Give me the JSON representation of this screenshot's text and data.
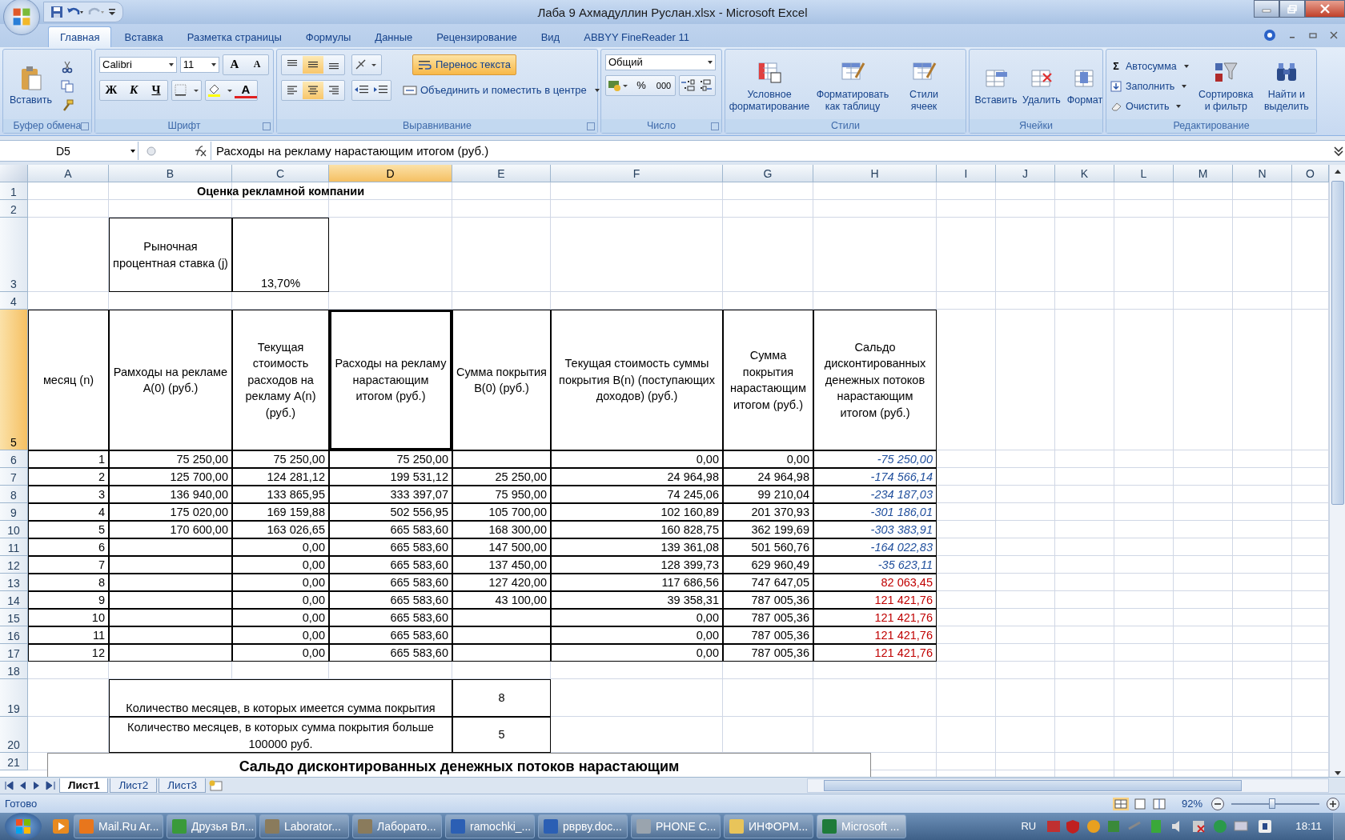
{
  "window": {
    "title": "Лаба 9 Ахмадуллин  Руслан.xlsx - Microsoft Excel"
  },
  "ribbon_tabs": [
    {
      "label": "Главная",
      "selected": true
    },
    {
      "label": "Вставка",
      "selected": false
    },
    {
      "label": "Разметка страницы",
      "selected": false
    },
    {
      "label": "Формулы",
      "selected": false
    },
    {
      "label": "Данные",
      "selected": false
    },
    {
      "label": "Рецензирование",
      "selected": false
    },
    {
      "label": "Вид",
      "selected": false
    },
    {
      "label": "ABBYY FineReader 11",
      "selected": false
    }
  ],
  "ribbon": {
    "clipboard": {
      "label": "Буфер обмена",
      "paste": "Вставить"
    },
    "font": {
      "label": "Шрифт",
      "family": "Calibri",
      "size": "11",
      "grow": "A",
      "shrink": "A",
      "styles": [
        "Ж",
        "К",
        "Ч"
      ],
      "color_letter": "A"
    },
    "alignment": {
      "label": "Выравнивание",
      "vertical": [
        {
          "selected": false
        },
        {
          "selected": true
        },
        {
          "selected": false
        }
      ],
      "horizontal": [
        {
          "selected": false
        },
        {
          "selected": true
        },
        {
          "selected": false
        }
      ],
      "wrap": {
        "label": "Перенос текста",
        "on": true
      },
      "merge": "Объединить и поместить в центре"
    },
    "number": {
      "label": "Число",
      "format": "Общий",
      "percent": "%",
      "thousands": "000"
    },
    "styles": {
      "label": "Стили",
      "buttons": [
        "Условное форматирование",
        "Форматировать как таблицу",
        "Стили ячеек"
      ]
    },
    "cells": {
      "label": "Ячейки",
      "buttons": [
        "Вставить",
        "Удалить",
        "Формат"
      ]
    },
    "editing": {
      "label": "Редактирование",
      "sum_sign": "Σ",
      "small": [
        "Автосумма",
        "Заполнить",
        "Очистить"
      ],
      "big": [
        "Сортировка и фильтр",
        "Найти и выделить"
      ]
    }
  },
  "formula_bar": {
    "name_box": "D5",
    "value": "Расходы на рекламу нарастающим итогом (руб.)"
  },
  "columns": [
    {
      "label": "A",
      "selected": false
    },
    {
      "label": "B",
      "selected": false
    },
    {
      "label": "C",
      "selected": false
    },
    {
      "label": "D",
      "selected": true
    },
    {
      "label": "E",
      "selected": false
    },
    {
      "label": "F",
      "selected": false
    },
    {
      "label": "G",
      "selected": false
    },
    {
      "label": "H",
      "selected": false
    },
    {
      "label": "I",
      "selected": false
    },
    {
      "label": "J",
      "selected": false
    },
    {
      "label": "K",
      "selected": false
    },
    {
      "label": "L",
      "selected": false
    },
    {
      "label": "M",
      "selected": false
    },
    {
      "label": "N",
      "selected": false
    },
    {
      "label": "O",
      "selected": false
    }
  ],
  "row_headers": [
    {
      "label": "1",
      "selected": false
    },
    {
      "label": "2",
      "selected": false
    },
    {
      "label": "3",
      "selected": false
    },
    {
      "label": "4",
      "selected": false
    },
    {
      "label": "5",
      "selected": true
    },
    {
      "label": "6",
      "selected": false
    },
    {
      "label": "7",
      "selected": false
    },
    {
      "label": "8",
      "selected": false
    },
    {
      "label": "9",
      "selected": false
    },
    {
      "label": "10",
      "selected": false
    },
    {
      "label": "11",
      "selected": false
    },
    {
      "label": "12",
      "selected": false
    },
    {
      "label": "13",
      "selected": false
    },
    {
      "label": "14",
      "selected": false
    },
    {
      "label": "15",
      "selected": false
    },
    {
      "label": "16",
      "selected": false
    },
    {
      "label": "17",
      "selected": false
    },
    {
      "label": "18",
      "selected": false
    },
    {
      "label": "19",
      "selected": false
    },
    {
      "label": "20",
      "selected": false
    },
    {
      "label": "21",
      "selected": false
    }
  ],
  "sheet_title": "Оценка рекламной компании",
  "rate": {
    "label": "Рыночная процентная ставка (j)",
    "value": "13,70%"
  },
  "table": {
    "headers": [
      "месяц (n)",
      "Рамходы на рекламе А(0)   (руб.)",
      "Текущая стоимость расходов на рекламу А(n) (руб.)",
      "Расходы на рекламу нарастающим итогом (руб.)",
      "Сумма покрытия В(0) (руб.)",
      "Текущая стоимость суммы покрытия В(n) (поступающих доходов) (руб.)",
      "Сумма покрытия нарастающим итогом (руб.)",
      "Сальдо дисконтированных денежных потоков нарастающим итогом (руб.)"
    ],
    "rows": [
      {
        "n": "1",
        "ads": "75 250,00",
        "ads_pv": "75 250,00",
        "ads_total": "75 250,00",
        "cover_pv": "0,00",
        "cover_total": "0,00",
        "balance": "-75 250,00",
        "kind": "negative"
      },
      {
        "n": "2",
        "ads": "125 700,00",
        "ads_pv": "124 281,12",
        "ads_total": "199 531,12",
        "cover": "25 250,00",
        "cover_pv": "24 964,98",
        "cover_total": "24 964,98",
        "balance": "-174 566,14",
        "kind": "negative"
      },
      {
        "n": "3",
        "ads": "136 940,00",
        "ads_pv": "133 865,95",
        "ads_total": "333 397,07",
        "cover": "75 950,00",
        "cover_pv": "74 245,06",
        "cover_total": "99 210,04",
        "balance": "-234 187,03",
        "kind": "negative"
      },
      {
        "n": "4",
        "ads": "175 020,00",
        "ads_pv": "169 159,88",
        "ads_total": "502 556,95",
        "cover": "105 700,00",
        "cover_pv": "102 160,89",
        "cover_total": "201 370,93",
        "balance": "-301 186,01",
        "kind": "negative"
      },
      {
        "n": "5",
        "ads": "170 600,00",
        "ads_pv": "163 026,65",
        "ads_total": "665 583,60",
        "cover": "168 300,00",
        "cover_pv": "160 828,75",
        "cover_total": "362 199,69",
        "balance": "-303 383,91",
        "kind": "negative"
      },
      {
        "n": "6",
        "ads_pv": "0,00",
        "ads_total": "665 583,60",
        "cover": "147 500,00",
        "cover_pv": "139 361,08",
        "cover_total": "501 560,76",
        "balance": "-164 022,83",
        "kind": "negative"
      },
      {
        "n": "7",
        "ads_pv": "0,00",
        "ads_total": "665 583,60",
        "cover": "137 450,00",
        "cover_pv": "128 399,73",
        "cover_total": "629 960,49",
        "balance": "-35 623,11",
        "kind": "negative"
      },
      {
        "n": "8",
        "ads_pv": "0,00",
        "ads_total": "665 583,60",
        "cover": "127 420,00",
        "cover_pv": "117 686,56",
        "cover_total": "747 647,05",
        "balance": "82 063,45",
        "kind": "positive"
      },
      {
        "n": "9",
        "ads_pv": "0,00",
        "ads_total": "665 583,60",
        "cover": "43 100,00",
        "cover_pv": "39 358,31",
        "cover_total": "787 005,36",
        "balance": "121 421,76",
        "kind": "positive"
      },
      {
        "n": "10",
        "ads_pv": "0,00",
        "ads_total": "665 583,60",
        "cover_pv": "0,00",
        "cover_total": "787 005,36",
        "balance": "121 421,76",
        "kind": "positive"
      },
      {
        "n": "11",
        "ads_pv": "0,00",
        "ads_total": "665 583,60",
        "cover_pv": "0,00",
        "cover_total": "787 005,36",
        "balance": "121 421,76",
        "kind": "positive"
      },
      {
        "n": "12",
        "ads_pv": "0,00",
        "ads_total": "665 583,60",
        "cover_pv": "0,00",
        "cover_total": "787 005,36",
        "balance": "121 421,76",
        "kind": "positive"
      }
    ]
  },
  "summary": [
    {
      "label": "Количество месяцев, в которых имеется сумма покрытия",
      "value": "8"
    },
    {
      "label": "Количество месяцев, в которых сумма покрытия больше 100000 руб.",
      "value": "5"
    }
  ],
  "chart": {
    "title": "Сальдо дисконтированных денежных потоков нарастающим"
  },
  "sheet_tabs": [
    {
      "label": "Лист1",
      "selected": true
    },
    {
      "label": "Лист2",
      "selected": false
    },
    {
      "label": "Лист3",
      "selected": false
    }
  ],
  "status_bar": {
    "status": "Готово",
    "zoom": {
      "label": "92%",
      "level": 0.46
    }
  },
  "taskbar": {
    "items": [
      {
        "label": "Mail.Ru Ar...",
        "selected": false,
        "color": "#e8761c"
      },
      {
        "label": "Друзья Вл...",
        "selected": false,
        "color": "#3a9a3a"
      },
      {
        "label": "Laborator...",
        "selected": false,
        "color": "#8a7b5c"
      },
      {
        "label": "Лаборато...",
        "selected": false,
        "color": "#8a7b5c"
      },
      {
        "label": "ramochki_...",
        "selected": false,
        "color": "#2b5fb4"
      },
      {
        "label": "рврву.doc...",
        "selected": false,
        "color": "#2b5fb4"
      },
      {
        "label": "PHONE C...",
        "selected": false,
        "color": "#9aa4ae"
      },
      {
        "label": "ИНФОРМ...",
        "selected": false,
        "color": "#e8c45a"
      },
      {
        "label": "Microsoft ...",
        "selected": true,
        "color": "#1e7b3a"
      }
    ],
    "language": "RU",
    "time": "18:11"
  }
}
